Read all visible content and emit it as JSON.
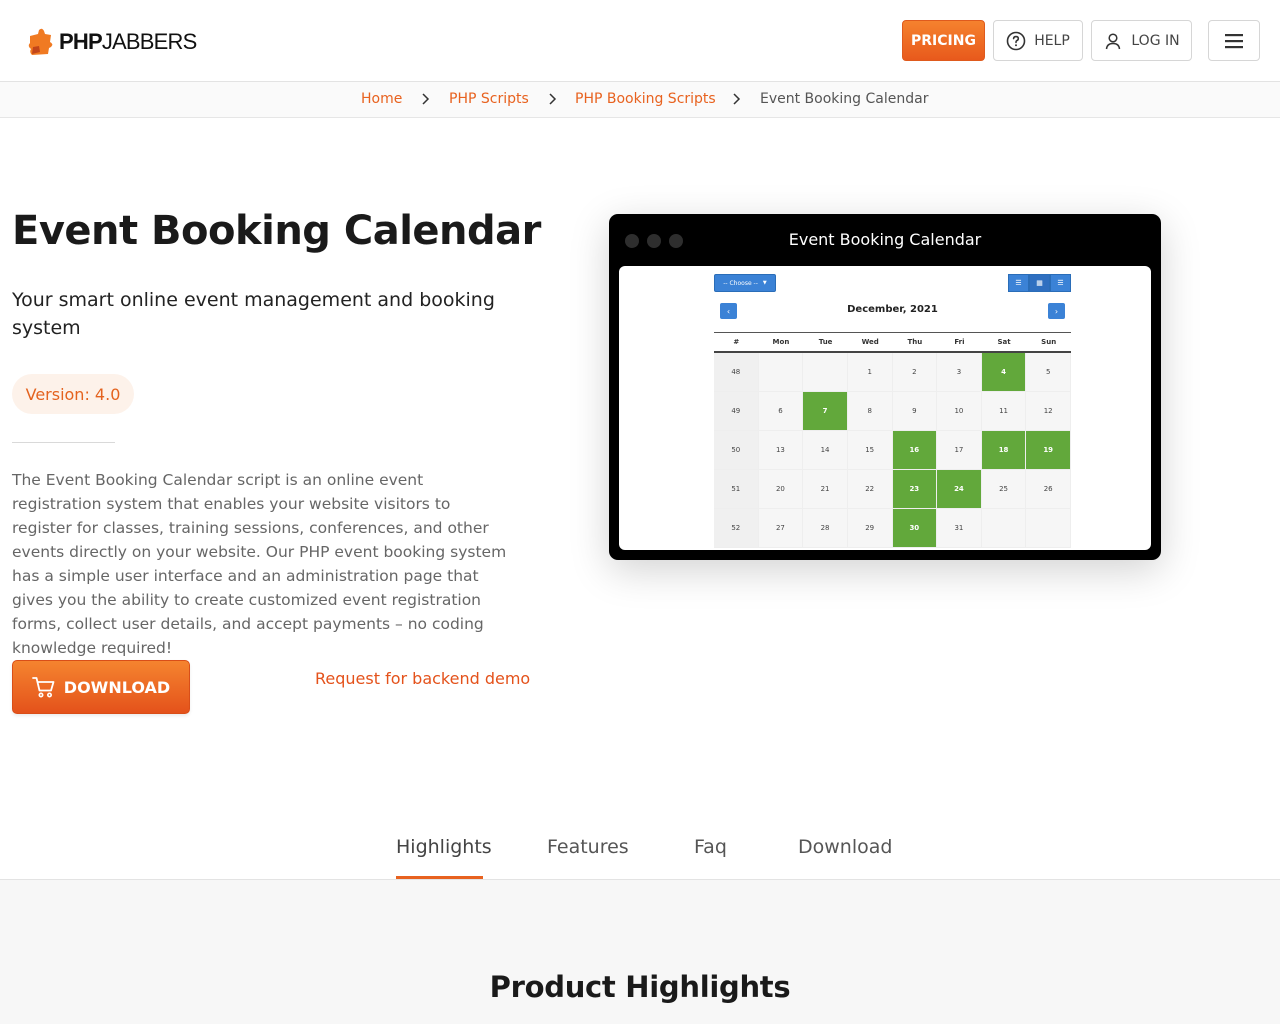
{
  "header": {
    "logo_bold": "PHP",
    "logo_light": "JABBERS",
    "pricing_label": "PRICING",
    "help_label": "HELP",
    "login_label": "LOG IN",
    "accent": "#e8621f"
  },
  "breadcrumb": {
    "items": [
      "Home",
      "PHP Scripts",
      "PHP Booking Scripts"
    ],
    "current": "Event Booking Calendar"
  },
  "hero": {
    "title": "Event Booking Calendar",
    "subtitle": "Your smart online event management and booking system",
    "version": "Version: 4.0",
    "description": "The Event Booking Calendar script is an online event registration system that enables your website visitors to register for classes, training sessions, conferences, and other events directly on your website. Our PHP event booking system has a simple user interface and an administration page that gives you the ability to create customized event registration forms, collect user details, and accept payments – no coding knowledge required!",
    "download_label": "DOWNLOAD",
    "demo_link": "Request for backend demo"
  },
  "preview": {
    "window_title": "Event Booking Calendar",
    "choose_label": "-- Choose --",
    "month": "December, 2021",
    "prev_label": "‹",
    "next_label": "›",
    "headers": [
      "#",
      "Mon",
      "Tue",
      "Wed",
      "Thu",
      "Fri",
      "Sat",
      "Sun"
    ],
    "rows": [
      [
        "48",
        "",
        "",
        "1",
        "2",
        "3",
        "4",
        "5"
      ],
      [
        "49",
        "6",
        "7",
        "8",
        "9",
        "10",
        "11",
        "12"
      ],
      [
        "50",
        "13",
        "14",
        "15",
        "16",
        "17",
        "18",
        "19"
      ],
      [
        "51",
        "20",
        "21",
        "22",
        "23",
        "24",
        "25",
        "26"
      ],
      [
        "52",
        "27",
        "28",
        "29",
        "30",
        "31",
        "",
        ""
      ]
    ],
    "booked_days": [
      "4",
      "7",
      "16",
      "18",
      "19",
      "23",
      "24",
      "30"
    ],
    "booked_color": "#62a83b"
  },
  "tabs": {
    "highlights": "Highlights",
    "features": "Features",
    "faq": "Faq",
    "download": "Download"
  },
  "section": {
    "title": "Product Highlights"
  }
}
